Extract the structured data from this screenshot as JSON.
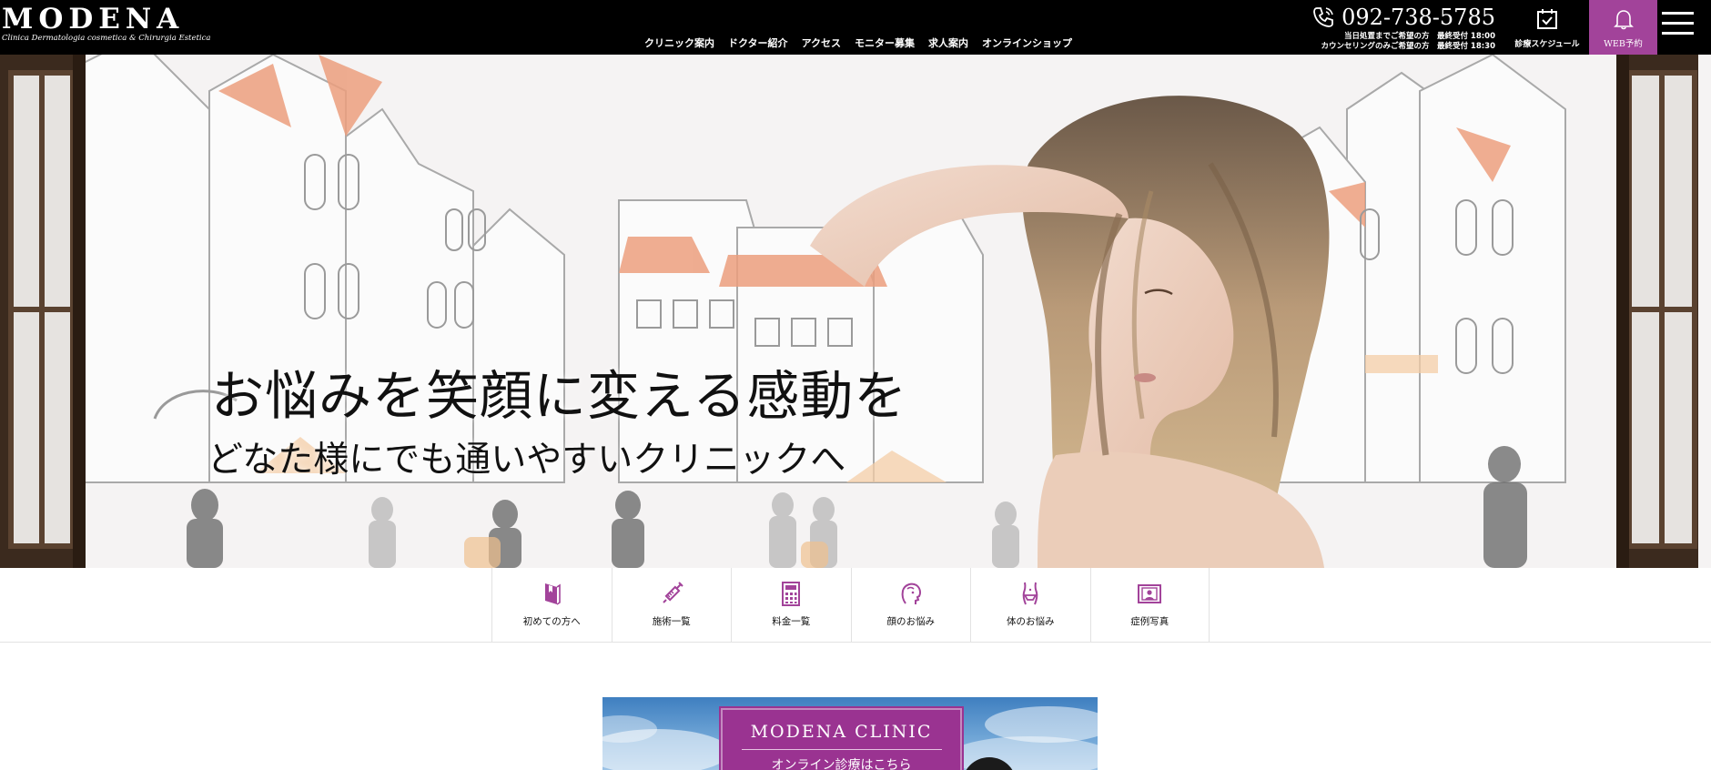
{
  "header": {
    "logo_text": "MODENA",
    "logo_tagline": "Clinica Dermatologia cosmetica & Chirurgia Estetica",
    "nav": [
      {
        "label": "クリニック案内"
      },
      {
        "label": "ドクター紹介"
      },
      {
        "label": "アクセス"
      },
      {
        "label": "モニター募集"
      },
      {
        "label": "求人案内"
      },
      {
        "label": "オンラインショップ"
      }
    ],
    "phone": "092-738-5785",
    "phone_notes": [
      "当日処置までご希望の方　最終受付 18:00",
      "カウンセリングのみご希望の方　最終受付 18:30"
    ],
    "schedule_label": "診療スケジュール",
    "web_reserve_label": "WEB予約",
    "accent_color": "#a2439a"
  },
  "hero": {
    "headline": "お悩みを笑顔に変える感動を",
    "subheadline": "どなた様にでも通いやすいクリニックへ"
  },
  "quick_menu": [
    {
      "label": "初めての方へ",
      "icon": "book-icon"
    },
    {
      "label": "施術一覧",
      "icon": "syringe-icon"
    },
    {
      "label": "料金一覧",
      "icon": "calculator-icon"
    },
    {
      "label": "顔のお悩み",
      "icon": "face-icon"
    },
    {
      "label": "体のお悩み",
      "icon": "body-icon"
    },
    {
      "label": "症例写真",
      "icon": "photo-icon"
    }
  ],
  "online_banner": {
    "title": "MODENA CLINIC",
    "subtitle": "オンライン診療はこちら"
  }
}
